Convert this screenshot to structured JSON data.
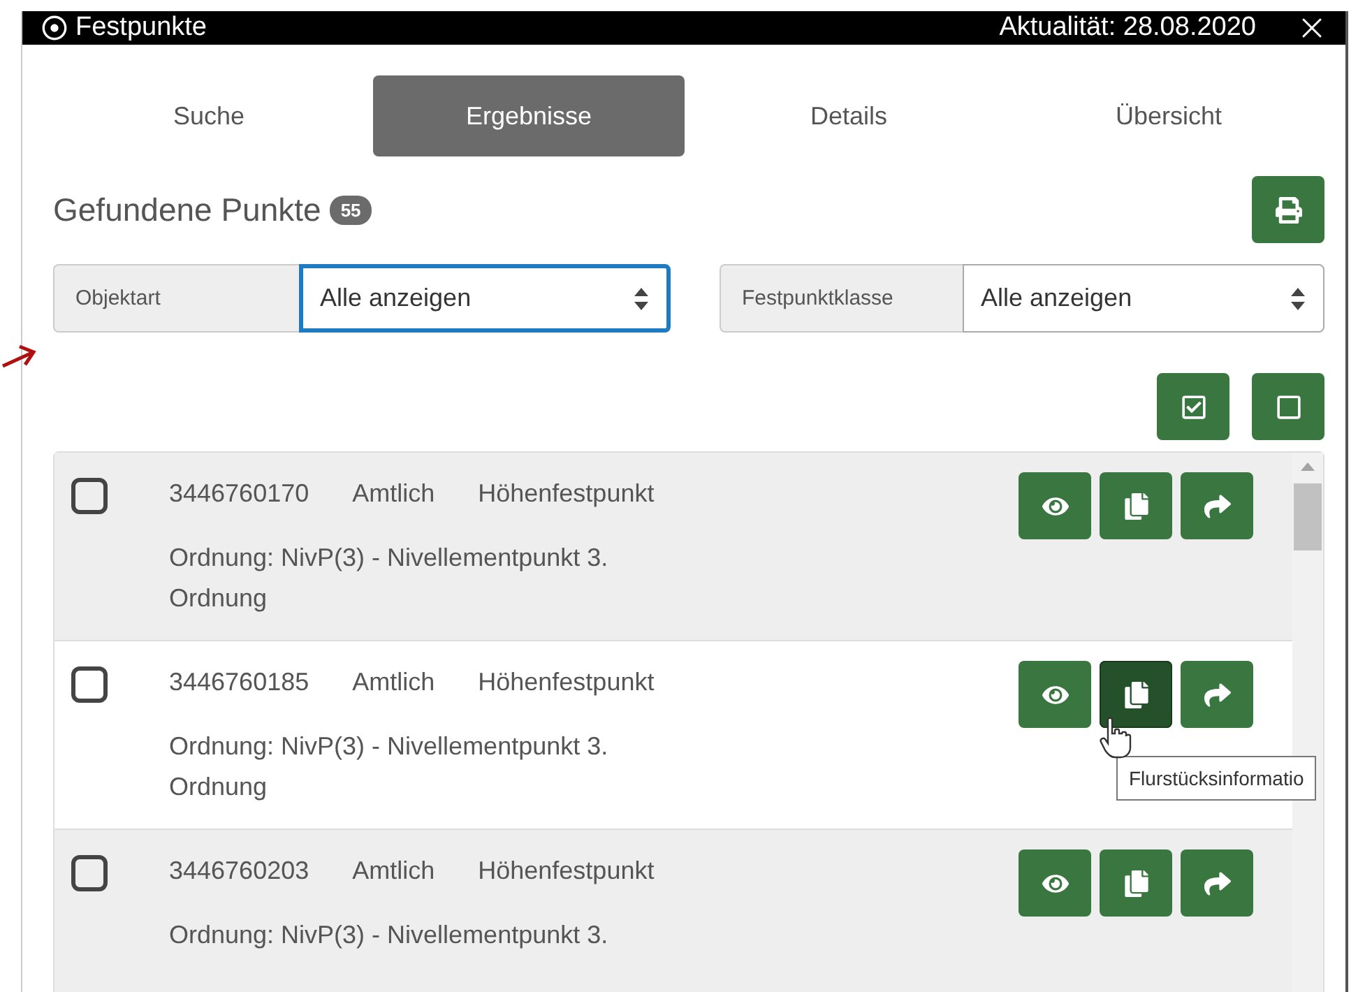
{
  "window": {
    "title": "Festpunkte",
    "currency": "Aktualität: 28.08.2020"
  },
  "tabs": [
    {
      "label": "Suche",
      "selected": false
    },
    {
      "label": "Ergebnisse",
      "selected": true
    },
    {
      "label": "Details",
      "selected": false
    },
    {
      "label": "Übersicht",
      "selected": false
    }
  ],
  "results": {
    "heading": "Gefundene Punkte",
    "count": "55"
  },
  "filters": [
    {
      "label": "Objektart",
      "value": "Alle anzeigen",
      "focused": true
    },
    {
      "label": "Festpunktklasse",
      "value": "Alle anzeigen",
      "focused": false
    }
  ],
  "rows": [
    {
      "checked": false,
      "number": "3446760170",
      "status": "Amtlich",
      "type": "Höhenfestpunkt",
      "order": "Ordnung: NivP(3) - Nivellementpunkt 3. Ordnung",
      "actions": [
        {
          "kind": "view",
          "hovered": false
        },
        {
          "kind": "parcel",
          "hovered": false
        },
        {
          "kind": "forward",
          "hovered": false
        }
      ]
    },
    {
      "checked": false,
      "number": "3446760185",
      "status": "Amtlich",
      "type": "Höhenfestpunkt",
      "order": "Ordnung: NivP(3) - Nivellementpunkt 3. Ordnung",
      "actions": [
        {
          "kind": "view",
          "hovered": false
        },
        {
          "kind": "parcel",
          "hovered": true
        },
        {
          "kind": "forward",
          "hovered": false
        }
      ]
    },
    {
      "checked": false,
      "number": "3446760203",
      "status": "Amtlich",
      "type": "Höhenfestpunkt",
      "order": "Ordnung: NivP(3) - Nivellementpunkt 3.",
      "actions": [
        {
          "kind": "view",
          "hovered": false
        },
        {
          "kind": "parcel",
          "hovered": false
        },
        {
          "kind": "forward",
          "hovered": false
        }
      ]
    }
  ],
  "tooltip": {
    "text": "Flurstücksinformatio"
  }
}
